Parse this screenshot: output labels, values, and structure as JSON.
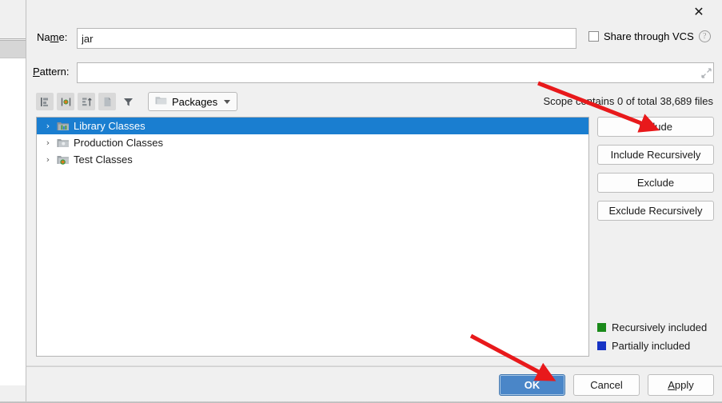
{
  "titlebar": {
    "close_label": "✕",
    "close_icon": "close-icon"
  },
  "form": {
    "name_label_pre": "Na",
    "name_label_mnemonic": "m",
    "name_label_post": "e:",
    "name_value": "jar",
    "name_placeholder": "",
    "pattern_label_mnemonic": "P",
    "pattern_label_post": "attern:",
    "pattern_value": "",
    "pattern_placeholder": "",
    "expand_icon": "expand-icon",
    "share_label": "Share through VCS",
    "share_checked": false,
    "help_icon": "?"
  },
  "toolbar": {
    "buttons": [
      {
        "name": "flatten-packages-icon",
        "title": "Flatten Packages"
      },
      {
        "name": "show-files-icon",
        "title": "Show Files"
      },
      {
        "name": "sort-icon",
        "title": "Sort"
      },
      {
        "name": "compact-packages-icon",
        "title": "Compact Middle Packages"
      },
      {
        "name": "filter-icon",
        "title": "Filter"
      }
    ],
    "combo_label": "Packages",
    "combo_icon": "folder-icon"
  },
  "scope_info": "Scope contains 0 of total 38,689 files",
  "tree": {
    "items": [
      {
        "label": "Library Classes",
        "selected": true,
        "twisty": "›",
        "icon": "library-folder-icon"
      },
      {
        "label": "Production Classes",
        "selected": false,
        "twisty": "›",
        "icon": "production-folder-icon"
      },
      {
        "label": "Test Classes",
        "selected": false,
        "twisty": "›",
        "icon": "test-folder-icon"
      }
    ]
  },
  "side_buttons": [
    {
      "label": "Include",
      "name": "include-button"
    },
    {
      "label": "Include Recursively",
      "name": "include-recursively-button"
    },
    {
      "label": "Exclude",
      "name": "exclude-button"
    },
    {
      "label": "Exclude Recursively",
      "name": "exclude-recursively-button"
    }
  ],
  "legend": [
    {
      "label": "Recursively included",
      "color": "#1a8a1a"
    },
    {
      "label": "Partially included",
      "color": "#1633c4"
    }
  ],
  "footer": {
    "ok_label": "OK",
    "cancel_label": "Cancel",
    "apply_label_mnemonic": "A",
    "apply_label_post": "pply"
  },
  "colors": {
    "selection_blue": "#1a7ed0",
    "primary_button": "#4a86c8",
    "annotation_red": "#e8191b",
    "dialog_background": "#f0f0f0"
  },
  "annotations": [
    {
      "name": "arrow-to-include-button",
      "target": "Include"
    },
    {
      "name": "arrow-to-ok-button",
      "target": "OK"
    }
  ]
}
